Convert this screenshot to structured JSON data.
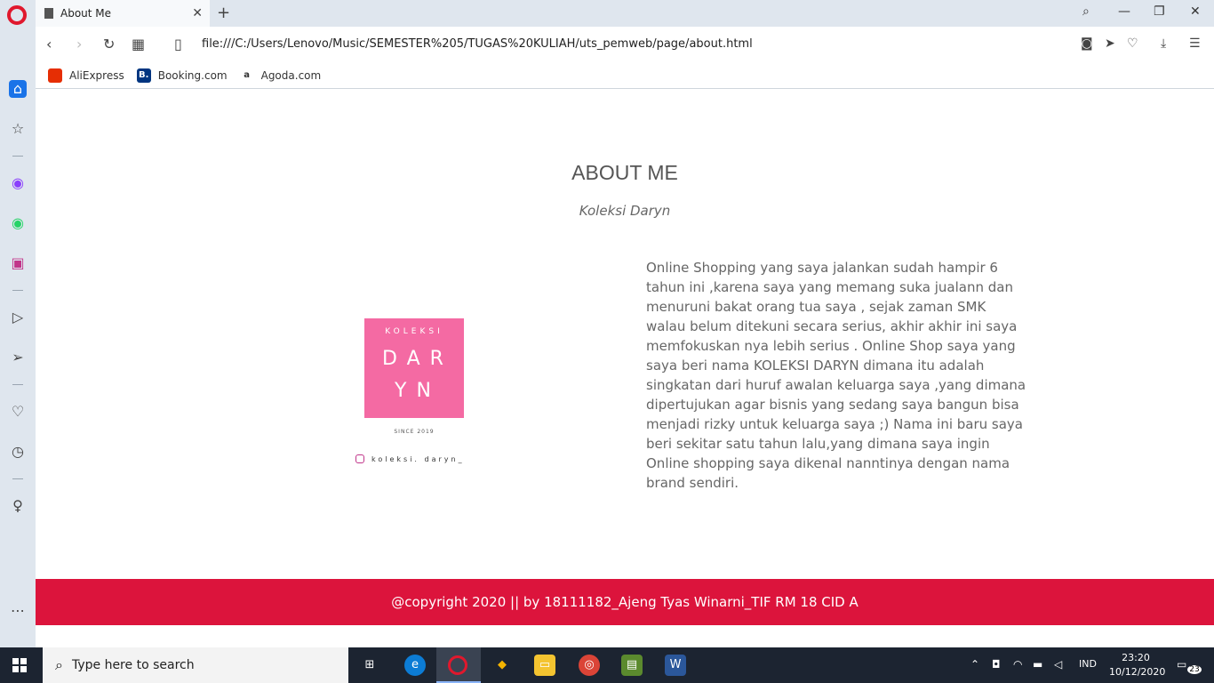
{
  "browser": {
    "tab_title": "About Me",
    "url": "file:///C:/Users/Lenovo/Music/SEMESTER%205/TUGAS%20KULIAH/uts_pemweb/page/about.html",
    "bookmarks": [
      {
        "label": "AliExpress",
        "color": "#e62e04"
      },
      {
        "label": "Booking.com",
        "color": "#003580"
      },
      {
        "label": "Agoda.com",
        "color": "#ffffff"
      }
    ]
  },
  "page": {
    "title": "ABOUT ME",
    "subtitle": "Koleksi Daryn",
    "logo": {
      "top": "KOLEKSI",
      "line1": "DAR",
      "line2": "YN",
      "since": "SINCE 2019",
      "instagram": "koleksi. daryn_"
    },
    "about_text": "Online Shopping yang saya jalankan sudah hampir 6 tahun ini ,karena saya yang memang suka jualann dan menuruni bakat orang tua saya , sejak zaman SMK walau belum ditekuni secara serius, akhir akhir ini saya memfokuskan nya lebih serius . Online Shop saya yang saya beri nama KOLEKSI DARYN dimana itu adalah singkatan dari huruf awalan keluarga saya ,yang dimana dipertujukan agar bisnis yang sedang saya bangun bisa menjadi rizky untuk keluarga saya ;) Nama ini baru saya beri sekitar satu tahun lalu,yang dimana saya ingin Online shopping saya dikenal nanntinya dengan nama brand sendiri.",
    "footer": "@copyright 2020 || by 18111182_Ajeng Tyas Winarni_TIF RM 18 CID A",
    "footer_color": "#dc143c",
    "logo_color": "#f46aa3"
  },
  "taskbar": {
    "search_placeholder": "Type here to search",
    "language": "IND",
    "time": "23:20",
    "date": "10/12/2020",
    "notification_count": "23"
  }
}
